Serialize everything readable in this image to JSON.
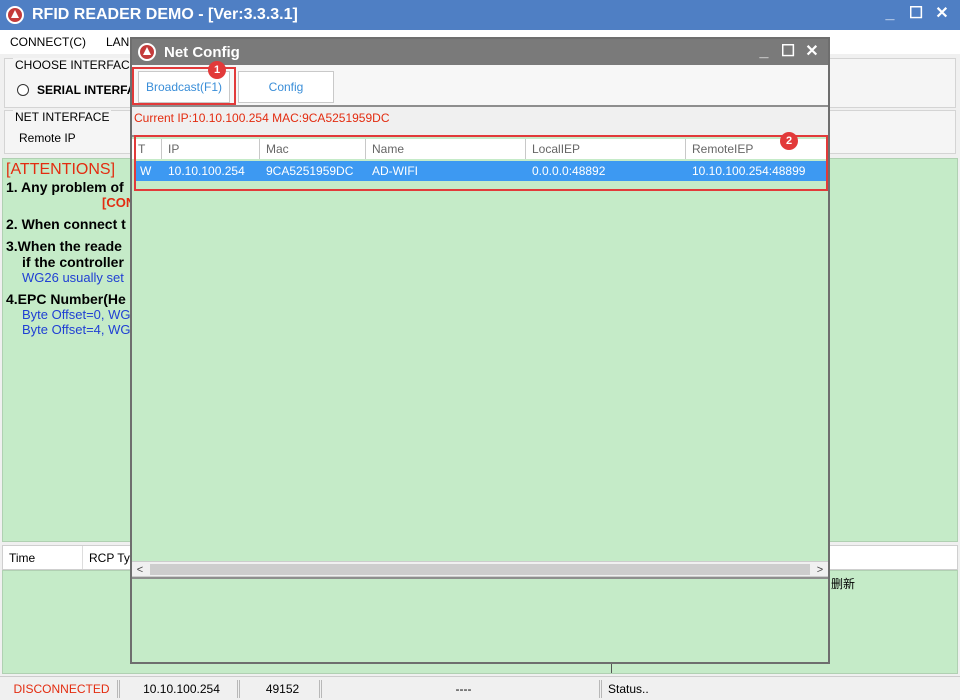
{
  "main": {
    "title": "RFID READER DEMO - [Ver:3.3.3.1]",
    "controls": [
      "_",
      "☐",
      "✕"
    ]
  },
  "menu": {
    "connect": "CONNECT(C)",
    "lang": "LAN"
  },
  "choose_interface": {
    "legend": "CHOOSE INTERFACE",
    "serial": "SERIAL INTERFA"
  },
  "net_interface": {
    "legend": "NET INTERFACE",
    "remote_ip_label": "Remote IP"
  },
  "attentions": {
    "title": "[ATTENTIONS]",
    "line1": "1. Any problem of",
    "line1_red": "[CON",
    "line2": "2. When connect t",
    "line3": "3.When the reade",
    "line3b": "if the controller",
    "line3c": "WG26 usually set",
    "line4": "4.EPC Number(He",
    "line4b": "Byte Offset=0, WG",
    "line4c": "Byte Offset=4, WG"
  },
  "log": {
    "col_time": "Time",
    "col_rcp": "RCP Typ",
    "fragment": "删新"
  },
  "status": {
    "connection": "DISCONNECTED",
    "ip": "10.10.100.254",
    "port": "49152",
    "blank": "----",
    "status": "Status.."
  },
  "dialog": {
    "title": "Net Config",
    "controls": [
      "_",
      "☐",
      "✕"
    ],
    "broadcast_label": "Broadcast(F1)",
    "config_label": "Config",
    "badge1": "1",
    "badge2": "2",
    "current_ip": "Current IP:10.10.100.254   MAC:9CA5251959DC",
    "columns": [
      "T",
      "IP",
      "Mac",
      "Name",
      "LocalIEP",
      "RemoteIEP"
    ],
    "row": {
      "t": "W",
      "ip": "10.10.100.254",
      "mac": "9CA5251959DC",
      "name": "AD-WIFI",
      "local": "0.0.0.0:48892",
      "remote": "10.10.100.254:48899"
    },
    "scroll_left": "<",
    "scroll_right": ">"
  },
  "colors": {
    "title_blue": "#4f7fc4",
    "panel_green": "#c5ebc8",
    "highlight_red": "#e23a3a",
    "selection_blue": "#3d99f2"
  }
}
